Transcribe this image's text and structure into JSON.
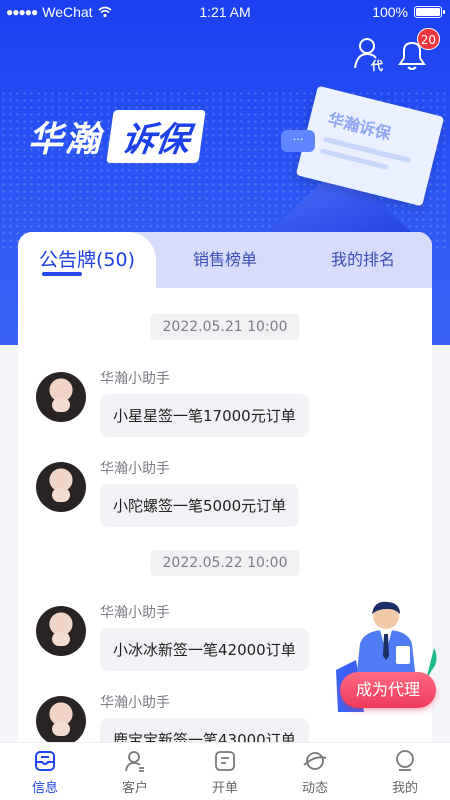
{
  "status_bar": {
    "carrier": "WeChat",
    "time": "1:21 AM",
    "battery": "100%"
  },
  "header": {
    "agent_icon": "agent-person-icon",
    "bell_icon": "bell-icon",
    "notification_count": "20"
  },
  "banner": {
    "title_left": "华瀚",
    "title_right": "诉保",
    "doc_text": "华瀚诉保"
  },
  "tabs": [
    {
      "label": "公告牌(50)",
      "active": true
    },
    {
      "label": "销售榜单",
      "active": false
    },
    {
      "label": "我的排名",
      "active": false
    }
  ],
  "feed": {
    "groups": [
      {
        "date": "2022.05.21 10:00",
        "messages": [
          {
            "sender": "华瀚小助手",
            "text": "小星星签一笔17000元订单"
          },
          {
            "sender": "华瀚小助手",
            "text": "小陀螺签一笔5000元订单"
          }
        ]
      },
      {
        "date": "2022.05.22 10:00",
        "messages": [
          {
            "sender": "华瀚小助手",
            "text": "小冰冰新签一笔42000订单"
          },
          {
            "sender": "华瀚小助手",
            "text": "鹿宝宝新签一笔43000订单"
          }
        ]
      }
    ]
  },
  "agent_button": "成为代理",
  "bottom_nav": [
    {
      "label": "信息",
      "icon": "message-icon",
      "active": true
    },
    {
      "label": "客户",
      "icon": "customer-icon",
      "active": false
    },
    {
      "label": "开单",
      "icon": "order-icon",
      "active": false
    },
    {
      "label": "动态",
      "icon": "planet-icon",
      "active": false
    },
    {
      "label": "我的",
      "icon": "profile-icon",
      "active": false
    }
  ],
  "colors": {
    "primary": "#1f46e8",
    "accent_pink": "#f0395a",
    "badge_red": "#f0353f"
  }
}
